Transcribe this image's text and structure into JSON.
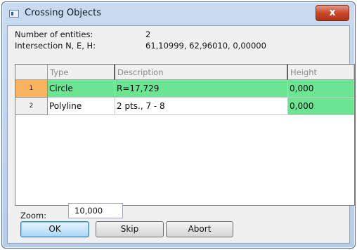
{
  "window": {
    "title": "Crossing Objects",
    "close_label": "x"
  },
  "info": {
    "entities_label": "Number of entities:",
    "entities_value": "2",
    "intersection_label": "Intersection N, E, H:",
    "intersection_value": "61,10999, 62,96010, 0,00000"
  },
  "grid": {
    "columns": [
      "Type",
      "Description",
      "Height"
    ],
    "rows": [
      {
        "num": "1",
        "type": "Circle",
        "description": "R=17,729",
        "height": "0,000"
      },
      {
        "num": "2",
        "type": "Polyline",
        "description": "2 pts., 7 - 8",
        "height": "0,000"
      }
    ],
    "colors": {
      "highlight": "#6be493",
      "selected_row_header": "#f9b25e"
    }
  },
  "zoom": {
    "label": "Zoom:",
    "value": "10,000"
  },
  "buttons": {
    "ok": "OK",
    "skip": "Skip",
    "abort": "Abort"
  }
}
